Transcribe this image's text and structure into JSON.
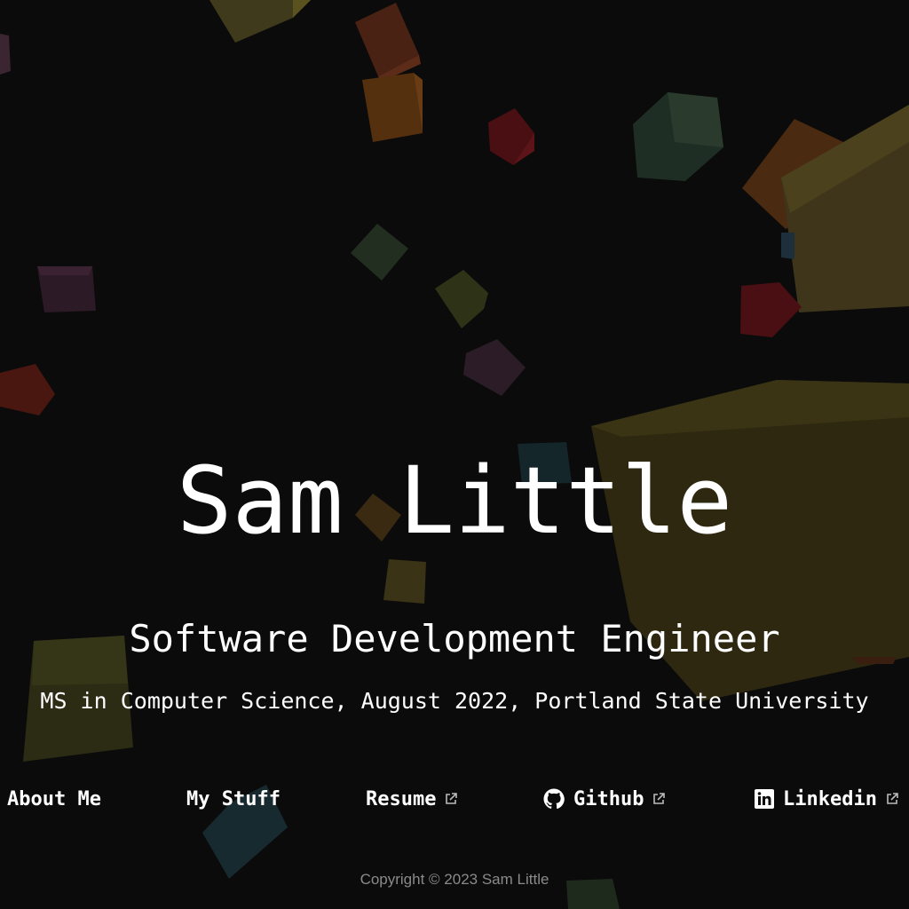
{
  "hero": {
    "name": "Sam Little",
    "title": "Software Development Engineer",
    "degree": "MS in Computer Science, August 2022, Portland State University"
  },
  "nav": {
    "about": "About Me",
    "stuff": "My Stuff",
    "resume": "Resume",
    "github": "Github",
    "linkedin": "Linkedin"
  },
  "icons": {
    "external": "external-link-icon",
    "github": "github-icon",
    "linkedin": "linkedin-icon"
  },
  "footer": {
    "copyright": "Copyright © 2023 Sam Little"
  },
  "colors": {
    "background": "#0b0b0b",
    "text": "#ffffff",
    "footer_text": "#8a8a8a"
  }
}
